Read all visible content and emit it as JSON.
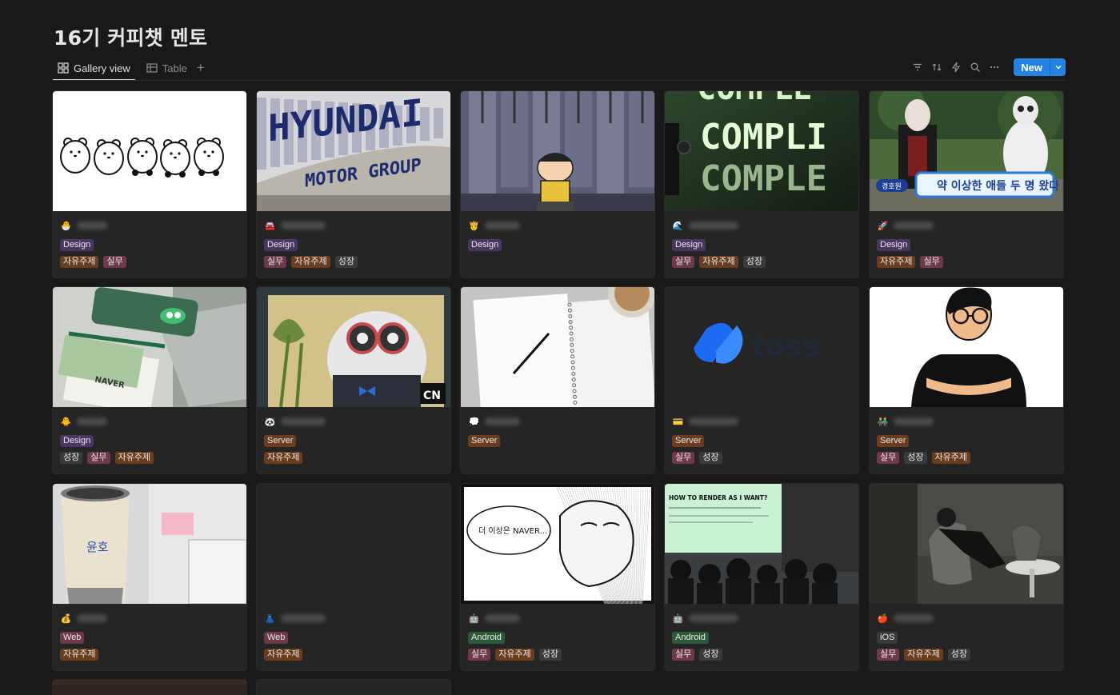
{
  "page": {
    "title": "16기 커피챗 멘토"
  },
  "views": {
    "tabs": [
      {
        "label": "Gallery view",
        "icon": "gallery-icon",
        "active": true
      },
      {
        "label": "Table",
        "icon": "table-icon",
        "active": false
      }
    ],
    "add_icon": "plus-icon"
  },
  "toolbar": {
    "icons": [
      "filter-icon",
      "sort-icon",
      "automation-icon",
      "search-icon",
      "more-icon"
    ],
    "new_label": "New",
    "new_chevron_icon": "chevron-down-icon"
  },
  "colors": {
    "Design": "#4b3563",
    "Server": "#6b3d1f",
    "Web": "#6e3a4a",
    "Android": "#2b5a3b",
    "iOS": "#3a3a3a",
    "자유주제": "#6b3d1f",
    "실무": "#6e3a4a",
    "성장": "#3a3a3a",
    "accent": "#2383e2"
  },
  "cards": [
    {
      "emoji": "🐣",
      "cover": "bears",
      "category": "Design",
      "tags": [
        "자유주제",
        "실무"
      ]
    },
    {
      "emoji": "🚘",
      "cover": "hyundai",
      "category": "Design",
      "tags": [
        "실무",
        "자유주제",
        "성장"
      ]
    },
    {
      "emoji": "🤴",
      "cover": "cartoon",
      "category": "Design",
      "tags": []
    },
    {
      "emoji": "🌊",
      "cover": "complex",
      "category": "Design",
      "tags": [
        "실무",
        "자유주제",
        "성장"
      ]
    },
    {
      "emoji": "🚀",
      "cover": "tvshow",
      "category": "Design",
      "tags": [
        "자유주제",
        "실무"
      ]
    },
    {
      "emoji": "🐥",
      "cover": "naver",
      "category": "Design",
      "tags": [
        "성장",
        "실무",
        "자유주제"
      ]
    },
    {
      "emoji": "🐼",
      "cover": "panda",
      "category": "Server",
      "tags": [
        "자유주제"
      ]
    },
    {
      "emoji": "💭",
      "cover": "notebook",
      "category": "Server",
      "tags": []
    },
    {
      "emoji": "💳",
      "cover": "toss",
      "category": "Server",
      "tags": [
        "실무",
        "성장"
      ]
    },
    {
      "emoji": "👬",
      "cover": "person",
      "category": "Server",
      "tags": [
        "실무",
        "성장",
        "자유주제"
      ]
    },
    {
      "emoji": "💰",
      "cover": "tumbler",
      "category": "Web",
      "tags": [
        "자유주제"
      ]
    },
    {
      "emoji": "👗",
      "cover": "empty",
      "category": "Web",
      "tags": [
        "자유주제"
      ]
    },
    {
      "emoji": "🤖",
      "cover": "manga",
      "category": "Android",
      "tags": [
        "실무",
        "자유주제",
        "성장"
      ]
    },
    {
      "emoji": "🤖",
      "cover": "seminar",
      "category": "Android",
      "tags": [
        "실무",
        "성장"
      ]
    },
    {
      "emoji": "🍎",
      "cover": "lounge",
      "category": "iOS",
      "tags": [
        "실무",
        "자유주제",
        "성장"
      ]
    }
  ],
  "cover_text": {
    "hyundai_top": "HYUNDAI",
    "hyundai_bottom": "MOTOR GROUP",
    "complex": "COMPLEX",
    "tv_caption": "약 이상한 애들 두 명 왔다",
    "tv_name": "경호원",
    "naver": "NAVER",
    "cn": "CN",
    "toss": "toss",
    "tumbler": "윤호",
    "manga_bubble": "더 이상은 NAVER...",
    "seminar_title": "HOW TO RENDER AS I WANT?"
  }
}
